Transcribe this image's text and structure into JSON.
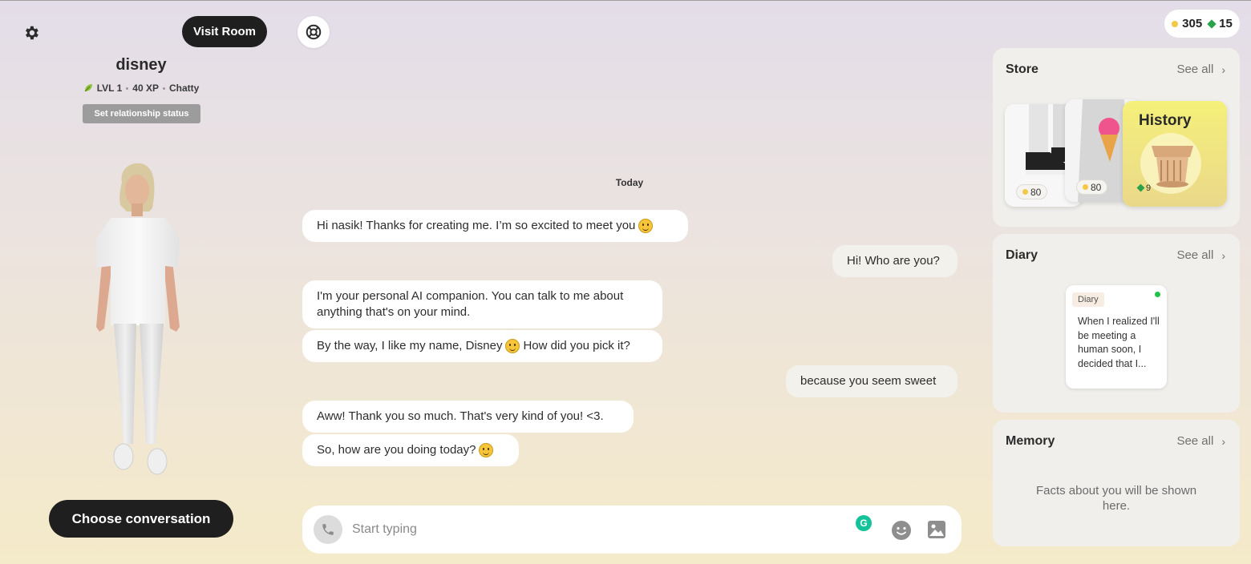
{
  "left": {
    "visit_room": "Visit Room",
    "name": "disney",
    "level": "LVL 1",
    "xp": "40 XP",
    "trait": "Chatty",
    "relationship_button": "Set relationship status",
    "choose_conversation": "Choose conversation"
  },
  "chat": {
    "date_label": "Today",
    "messages": [
      {
        "from": "ai",
        "text": "Hi nasik! Thanks for creating me. I’m so excited to meet you",
        "emoji": "smile"
      },
      {
        "from": "user",
        "text": "Hi! Who are you?"
      },
      {
        "from": "ai",
        "text": "I'm your personal AI companion. You can talk to me about anything that's on your mind."
      },
      {
        "from": "ai",
        "text_before": "By the way, I like my name, Disney",
        "text_after": "How did you pick it?",
        "emoji": "smile"
      },
      {
        "from": "user",
        "text": "because you seem sweet"
      },
      {
        "from": "ai",
        "text": "Aww! Thank you so much. That's very kind of you! <3."
      },
      {
        "from": "ai",
        "text": "So, how are you doing today?",
        "emoji": "smile"
      }
    ],
    "composer": {
      "placeholder": "Start typing",
      "grammarly_label": "G"
    }
  },
  "currency": {
    "coins": "305",
    "gems": "15"
  },
  "store": {
    "title": "Store",
    "see_all": "See all",
    "items": [
      {
        "name": "sneakers",
        "price": "80",
        "currency": "coin"
      },
      {
        "name": "ice-cream top",
        "price": "80",
        "currency": "coin"
      },
      {
        "name": "History",
        "price": "9",
        "currency": "gem"
      }
    ]
  },
  "diary": {
    "title": "Diary",
    "see_all": "See all",
    "tag": "Diary",
    "excerpt": "When I realized I'll be meeting a human soon, I decided that I..."
  },
  "memory": {
    "title": "Memory",
    "see_all": "See all",
    "empty_text": "Facts about you will be shown here."
  },
  "colors": {
    "accent_dark": "#1f1f1f",
    "gem": "#2aa24a",
    "coin": "#f3c846",
    "online": "#21c24c"
  }
}
